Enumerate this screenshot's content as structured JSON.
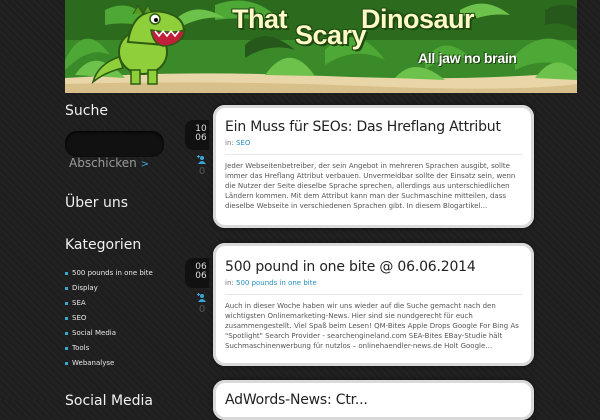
{
  "site": {
    "title_words": [
      "That",
      "Scary",
      "Dinosaur"
    ],
    "tagline": "All jaw no brain"
  },
  "sidebar": {
    "search_title": "Suche",
    "search_button": "Abschicken",
    "search_arrow": ">",
    "about_title": "Über uns",
    "categories_title": "Kategorien",
    "categories": [
      "500 pounds in one bite",
      "Display",
      "SEA",
      "SEO",
      "Social Media",
      "Tools",
      "Webanalyse"
    ],
    "social_title": "Social Media"
  },
  "posts": [
    {
      "day": "10",
      "month": "06",
      "comments": "0",
      "title": "Ein Muss für SEOs: Das Hreflang Attribut",
      "in_label": "in:",
      "category": "SEO",
      "excerpt": "Jeder Webseitenbetreiber, der sein Angebot in mehreren Sprachen ausgibt, sollte immer das Hreflang Attribut verbauen. Unvermeidbar sollte der Einsatz sein, wenn die Nutzer der Seite dieselbe Sprache sprechen, allerdings aus unterschiedlichen Ländern kommen. Mit dem Attribut kann man der Suchmaschine mitteilen, dass dieselbe Webseite in verschiedenen Sprachen gibt. In diesem Blogartikel…"
    },
    {
      "day": "06",
      "month": "06",
      "comments": "0",
      "title": "500 pound in one bite @ 06.06.2014",
      "in_label": "in:",
      "category": "500 pounds in one bite",
      "excerpt": "Auch in dieser Woche haben wir uns wieder auf die Suche gemacht nach den wichtigsten Onlinemarketing-News. Hier sind sie nundgerecht für euch zusammengestellt. Viel Spaß beim Lesen! QM-Bites Apple Drops Google For Bing As \"Spotlight\" Search Provider - searchengineland.com   SEA-Bites EBay-Studie hält Suchmaschinenwerbung für nutzlos – onlinehaendler-news.de Holt Google…"
    },
    {
      "title": "AdWords-News: Ctr..."
    }
  ],
  "colors": {
    "accent": "#3aa6d6",
    "background": "#1e1e1e",
    "banner_text": "#fff9c8"
  }
}
